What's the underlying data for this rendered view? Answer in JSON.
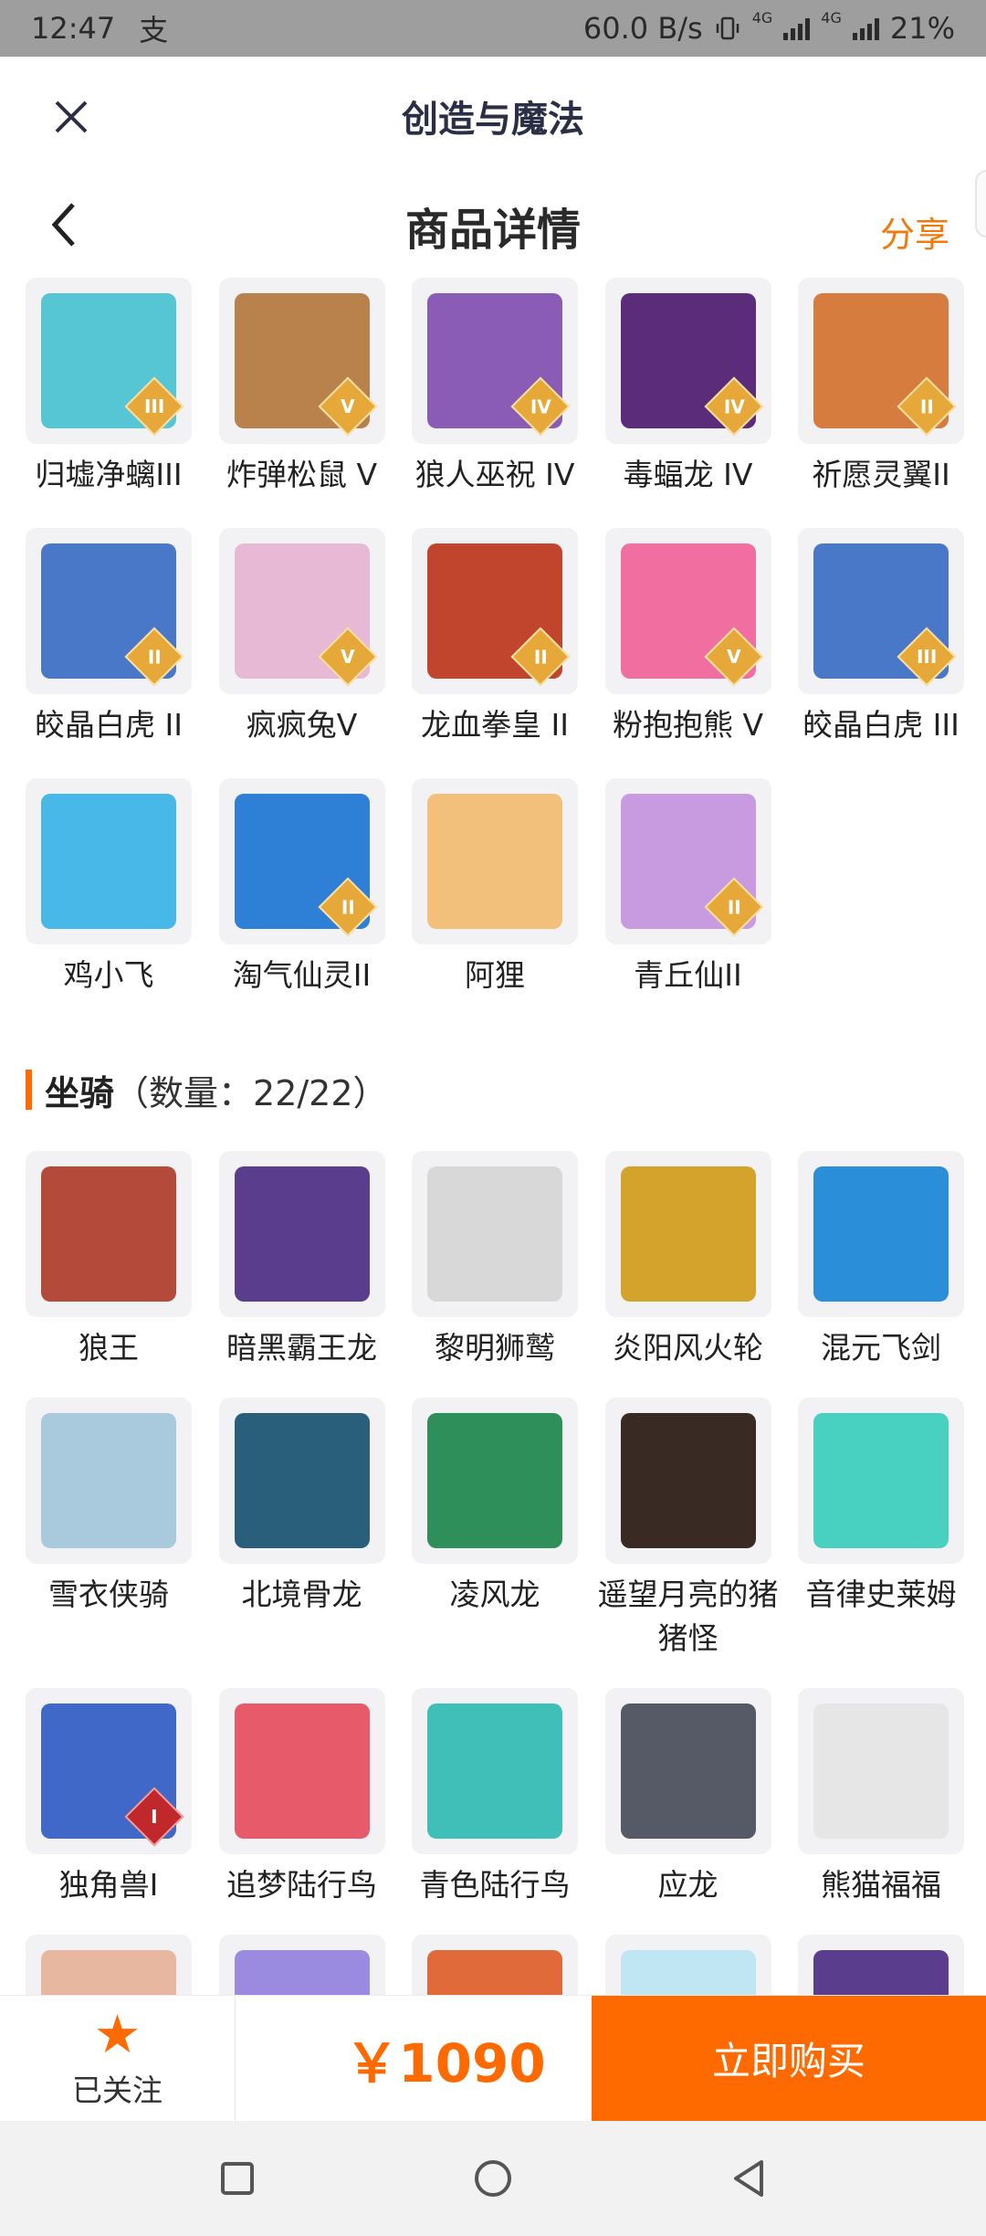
{
  "status_bar": {
    "time": "12:47",
    "app_notification_icon": "支",
    "speed": "60.0 B/s",
    "network_1": "4G",
    "network_2": "4G",
    "battery": "21%"
  },
  "header": {
    "app_title": "创造与魔法",
    "page_title": "商品详情",
    "share_label": "分享"
  },
  "pets": [
    {
      "name": "归墟净螭III",
      "rank": "III",
      "color": "#56c5d4"
    },
    {
      "name": "炸弹松鼠 V",
      "rank": "V",
      "color": "#b9824d"
    },
    {
      "name": "狼人巫祝 IV",
      "rank": "IV",
      "color": "#8a5cb6"
    },
    {
      "name": "毒蝠龙 IV",
      "rank": "IV",
      "color": "#5a2c7a"
    },
    {
      "name": "祈愿灵翼II",
      "rank": "II",
      "color": "#d67c3f"
    },
    {
      "name": "皎晶白虎 II",
      "rank": "II",
      "color": "#4a78c8"
    },
    {
      "name": "疯疯兔V",
      "rank": "V",
      "color": "#e8b9d5"
    },
    {
      "name": "龙血拳皇 II",
      "rank": "II",
      "color": "#c0452c"
    },
    {
      "name": "粉抱抱熊 V",
      "rank": "V",
      "color": "#f06fa0"
    },
    {
      "name": "皎晶白虎 III",
      "rank": "III",
      "color": "#4a78c8"
    },
    {
      "name": "鸡小飞",
      "rank": "",
      "color": "#47b8e8"
    },
    {
      "name": "淘气仙灵II",
      "rank": "II",
      "color": "#2e7fd6"
    },
    {
      "name": "阿狸",
      "rank": "",
      "color": "#f2c07a"
    },
    {
      "name": "青丘仙II",
      "rank": "II",
      "color": "#c89ae0"
    }
  ],
  "mounts_section": {
    "title": "坐骑",
    "count": "（数量：22/22）"
  },
  "mounts": [
    {
      "name": "狼王",
      "rank": "",
      "color": "#b44a3a"
    },
    {
      "name": "暗黑霸王龙",
      "rank": "",
      "color": "#5b3d8e"
    },
    {
      "name": "黎明狮鹫",
      "rank": "",
      "color": "#d8d8d8"
    },
    {
      "name": "炎阳风火轮",
      "rank": "",
      "color": "#d4a32c"
    },
    {
      "name": "混元飞剑",
      "rank": "",
      "color": "#2a8fd8"
    },
    {
      "name": "雪衣侠骑",
      "rank": "",
      "color": "#a9c9dc"
    },
    {
      "name": "北境骨龙",
      "rank": "",
      "color": "#2a5f7c"
    },
    {
      "name": "凌风龙",
      "rank": "",
      "color": "#2f8f5a"
    },
    {
      "name": "遥望月亮的猪猪怪",
      "rank": "",
      "color": "#3a2a24"
    },
    {
      "name": "音律史莱姆",
      "rank": "",
      "color": "#48d0c0"
    },
    {
      "name": "独角兽I",
      "rank": "I",
      "color": "#4068c8"
    },
    {
      "name": "追梦陆行鸟",
      "rank": "",
      "color": "#e65a6a"
    },
    {
      "name": "青色陆行鸟",
      "rank": "",
      "color": "#3fbfb8"
    },
    {
      "name": "应龙",
      "rank": "",
      "color": "#555a66"
    },
    {
      "name": "熊猫福福",
      "rank": "",
      "color": "#e6e6e6"
    },
    {
      "name": "",
      "rank": "",
      "color": "#e8b7a0"
    },
    {
      "name": "",
      "rank": "",
      "color": "#9a8ae0"
    },
    {
      "name": "",
      "rank": "",
      "color": "#e06a3a"
    },
    {
      "name": "",
      "rank": "",
      "color": "#bfe6f2"
    },
    {
      "name": "",
      "rank": "",
      "color": "#5b3d8e"
    }
  ],
  "bottom_bar": {
    "follow_label": "已关注",
    "price": "￥1090",
    "buy_label": "立即购买"
  },
  "colors": {
    "accent": "#ff6a00",
    "share": "#f07a0c",
    "header_title": "#2b2f45"
  }
}
